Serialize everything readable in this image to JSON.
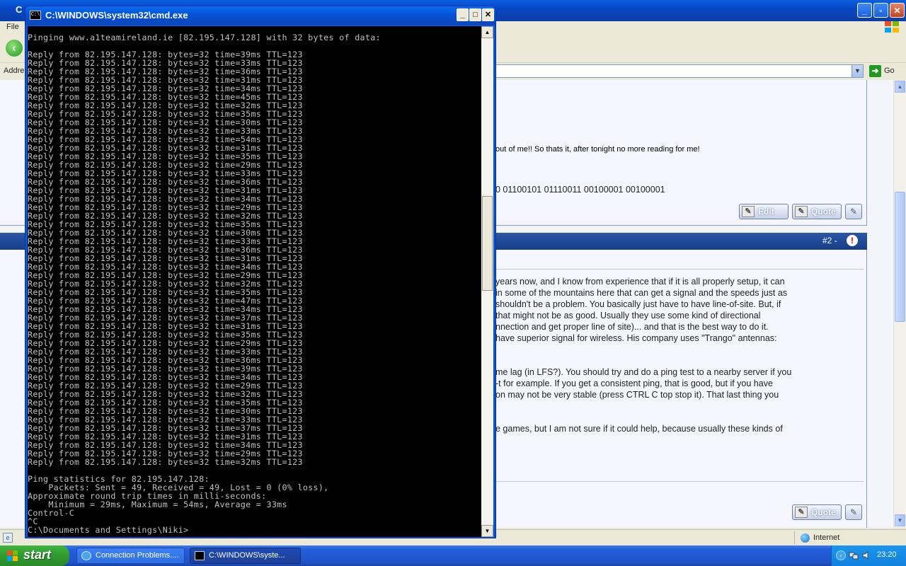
{
  "browser": {
    "title": "C",
    "menu_file": "File",
    "address_label": "Addre",
    "go_label": "Go",
    "status_zone": "Internet"
  },
  "post1": {
    "text_line": "out of me!! So thats it, after tonight no more reading for me!",
    "binary_line": "0 01100101 01110011 00100001 00100001",
    "edit_label": "Edit",
    "quote_label": "Quote"
  },
  "post2": {
    "number_label": "#2 -",
    "lines": [
      "years now, and I know from experience that if it is all properly setup, it can",
      "in some of the mountains here that can get a signal and the speeds just as",
      "shouldn't be a problem. You basically just have to have line-of-site. But, if",
      "that might not be as good. Usually they use some kind of directional",
      "nnection and get proper line of site)... and that is the best way to do it.",
      "have superior signal for wireless. His company uses \"Trango\" antennas:",
      "me lag (in LFS?). You should try and do a ping test to a nearby server if you",
      "-t for example. If you get a consistent ping, that is good, but if you have",
      "on may not be very stable (press CTRL C top stop it). That last thing you",
      "e games, but I am not sure if it could help, because usually these kinds of"
    ],
    "quote_label": "Quote"
  },
  "cmd": {
    "title": "C:\\WINDOWS\\system32\\cmd.exe",
    "icon_text": "C:\\",
    "header": "Pinging www.a1teamireland.ie [82.195.147.128] with 32 bytes of data:",
    "reply_prefix": "Reply from 82.195.147.128: bytes=32 time=",
    "reply_suffix": "ms TTL=123",
    "times": [
      39,
      33,
      36,
      31,
      34,
      45,
      32,
      35,
      30,
      33,
      54,
      31,
      35,
      29,
      33,
      36,
      31,
      34,
      29,
      32,
      35,
      30,
      33,
      36,
      31,
      34,
      29,
      32,
      35,
      47,
      34,
      37,
      31,
      35,
      29,
      33,
      36,
      39,
      34,
      29,
      32,
      35,
      30,
      33,
      37,
      31,
      34,
      29,
      32
    ],
    "stats": [
      "Ping statistics for 82.195.147.128:",
      "    Packets: Sent = 49, Received = 49, Lost = 0 (0% loss),",
      "Approximate round trip times in milli-seconds:",
      "    Minimum = 29ms, Maximum = 54ms, Average = 33ms",
      "Control-C",
      "^C",
      "C:\\Documents and Settings\\Niki>"
    ]
  },
  "taskbar": {
    "start_label": "start",
    "ie_button": "Connection Problems....",
    "cmd_button": "C:\\WINDOWS\\syste...",
    "clock": "23:20"
  },
  "colors": {
    "cmd_text": "#c0c0c0",
    "cmd_bg": "#000000",
    "xp_blue": "#245edb",
    "start_green": "#2f9a2f",
    "forum_header": "#2a57a6"
  }
}
